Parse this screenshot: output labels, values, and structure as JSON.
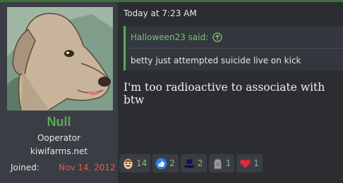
{
  "user": {
    "name": "Null",
    "title": "Ooperator",
    "site": "kiwifarms.net",
    "joined_label": "Joined:",
    "joined_date": "Nov 14, 2012",
    "avatar_icon": "dog-avatar"
  },
  "post": {
    "date": "Today at 7:23 AM",
    "quote": {
      "author": "Halloween23 said:",
      "icon": "arrow-up-circle-icon",
      "text": "betty just attempted suicide live on kick"
    },
    "body": "I'm too radioactive to associate with btw"
  },
  "reactions": [
    {
      "name": "reaction-laugh",
      "icon": "laugh-face-icon",
      "count": "14"
    },
    {
      "name": "reaction-like",
      "icon": "thumbs-up-icon",
      "count": "2"
    },
    {
      "name": "reaction-top-hat",
      "icon": "top-hat-icon",
      "count": "2"
    },
    {
      "name": "reaction-rip",
      "icon": "tombstone-icon",
      "count": "1"
    },
    {
      "name": "reaction-heart",
      "icon": "heart-icon",
      "count": "1"
    }
  ],
  "colors": {
    "accent": "#5fa85a",
    "joined_date": "#e05a5a",
    "panel": "#3a3d44",
    "background": "#2b2d31"
  }
}
